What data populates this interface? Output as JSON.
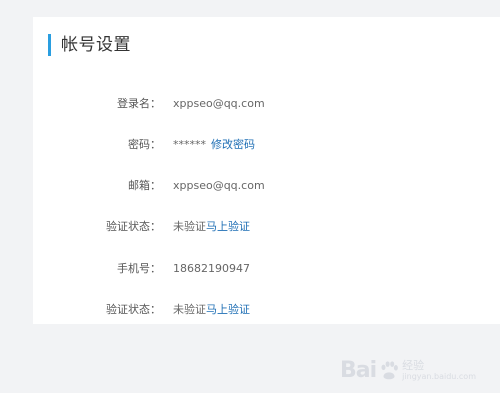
{
  "header": {
    "title": "帐号设置"
  },
  "rows": [
    {
      "label": "登录名：",
      "value": "xppseo@qq.com"
    },
    {
      "label": "密码：",
      "value": "******",
      "link": "修改密码"
    },
    {
      "label": "邮箱：",
      "value": "xppseo@qq.com"
    },
    {
      "label": "验证状态：",
      "value": "未验证",
      "link": "马上验证"
    },
    {
      "label": "手机号：",
      "value": "18682190947"
    },
    {
      "label": "验证状态：",
      "value": "未验证",
      "link": "马上验证"
    }
  ],
  "watermark": {
    "brand": "Bai",
    "jingyan": "经验",
    "url": "jingyan.baidu.com"
  },
  "colors": {
    "accent": "#2a9ee0",
    "link": "#1f6fb5",
    "background": "#f2f3f5"
  }
}
